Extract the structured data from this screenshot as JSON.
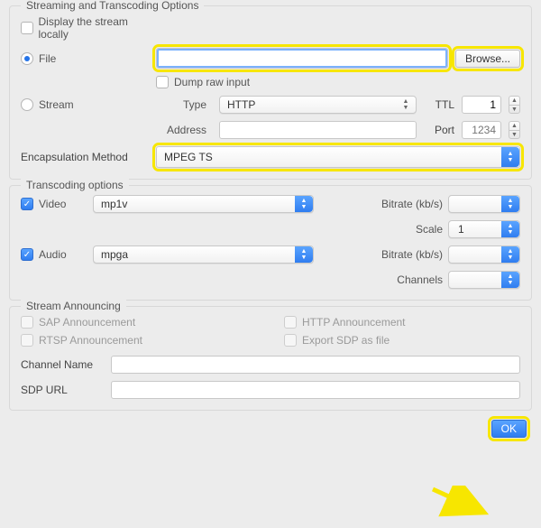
{
  "streaming": {
    "legend": "Streaming and Transcoding Options",
    "display_locally_label": "Display the stream locally",
    "display_locally_checked": false,
    "file": {
      "label": "File",
      "selected": true,
      "path": "",
      "browse_label": "Browse...",
      "dump_raw_label": "Dump raw input",
      "dump_raw_checked": false
    },
    "stream": {
      "label": "Stream",
      "selected": false,
      "type_label": "Type",
      "type_value": "HTTP",
      "ttl_label": "TTL",
      "ttl_value": "1",
      "address_label": "Address",
      "address_value": "",
      "port_label": "Port",
      "port_placeholder": "1234"
    },
    "encap_label": "Encapsulation Method",
    "encap_value": "MPEG TS"
  },
  "transcoding": {
    "legend": "Transcoding options",
    "video": {
      "enabled": true,
      "label": "Video",
      "codec": "mp1v",
      "bitrate_label": "Bitrate (kb/s)",
      "bitrate_value": "",
      "scale_label": "Scale",
      "scale_value": "1"
    },
    "audio": {
      "enabled": true,
      "label": "Audio",
      "codec": "mpga",
      "bitrate_label": "Bitrate (kb/s)",
      "bitrate_value": "",
      "channels_label": "Channels",
      "channels_value": ""
    }
  },
  "announcing": {
    "legend": "Stream Announcing",
    "sap_label": "SAP Announcement",
    "rtsp_label": "RTSP Announcement",
    "http_label": "HTTP Announcement",
    "export_sdp_label": "Export SDP as file",
    "channel_name_label": "Channel Name",
    "channel_name_value": "",
    "sdp_url_label": "SDP URL",
    "sdp_url_value": ""
  },
  "footer": {
    "ok_label": "OK"
  }
}
